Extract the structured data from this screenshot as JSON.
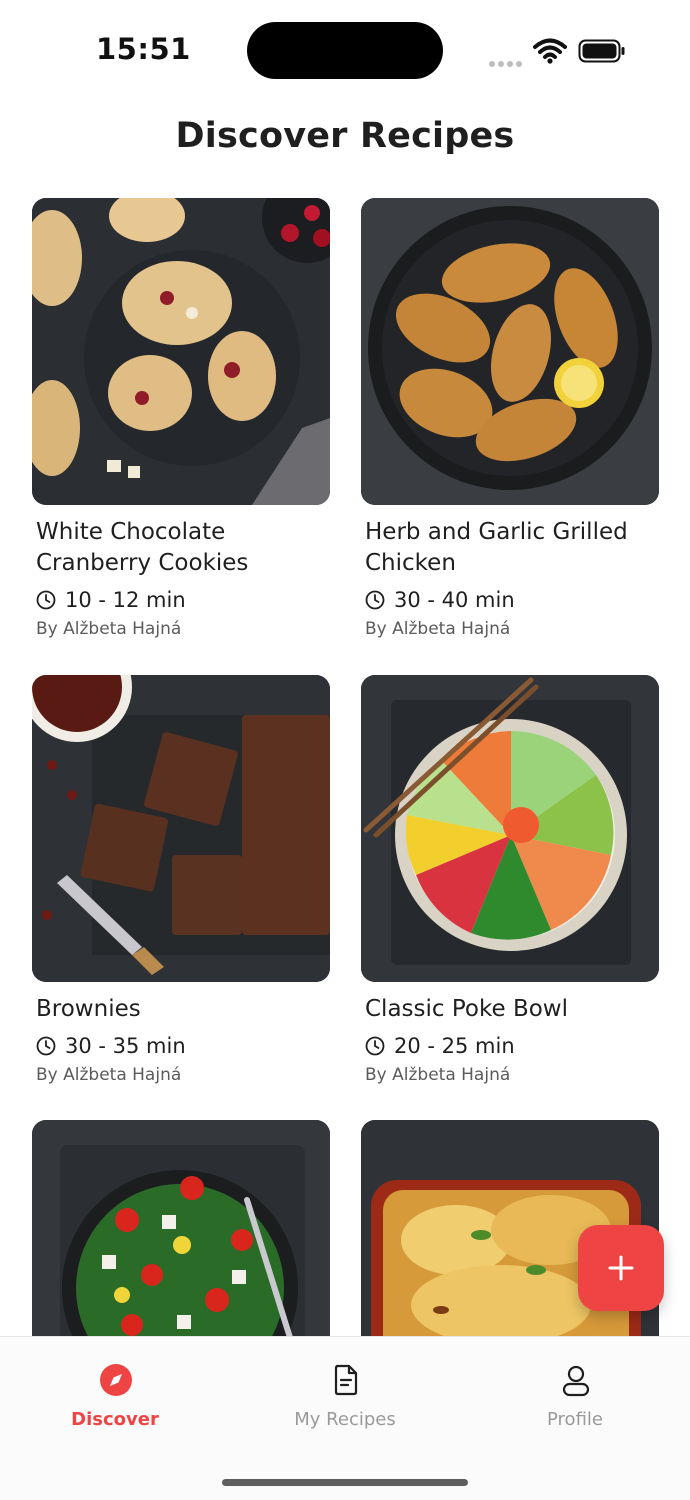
{
  "status_bar": {
    "time": "15:51"
  },
  "header": {
    "title": "Discover Recipes"
  },
  "recipes": [
    {
      "title_line1": "White Chocolate",
      "title_line2": "Cranberry Cookies",
      "time": "10 - 12 min",
      "author": "By Alžbeta Hajná"
    },
    {
      "title_line1": "Herb and Garlic Grilled",
      "title_line2": "Chicken",
      "time": "30 - 40 min",
      "author": "By Alžbeta Hajná"
    },
    {
      "title_line1": "Brownies",
      "title_line2": "",
      "time": "30 - 35 min",
      "author": "By Alžbeta Hajná"
    },
    {
      "title_line1": "Classic Poke Bowl",
      "title_line2": "",
      "time": "20 - 25 min",
      "author": "By Alžbeta Hajná"
    }
  ],
  "fab": {
    "icon": "plus-icon"
  },
  "tabs": [
    {
      "label": "Discover",
      "icon": "compass-icon",
      "active": true
    },
    {
      "label": "My Recipes",
      "icon": "document-icon",
      "active": false
    },
    {
      "label": "Profile",
      "icon": "person-icon",
      "active": false
    }
  ],
  "colors": {
    "accent": "#ef4444",
    "text": "#1f1f1f",
    "muted": "#9a9a9a"
  }
}
